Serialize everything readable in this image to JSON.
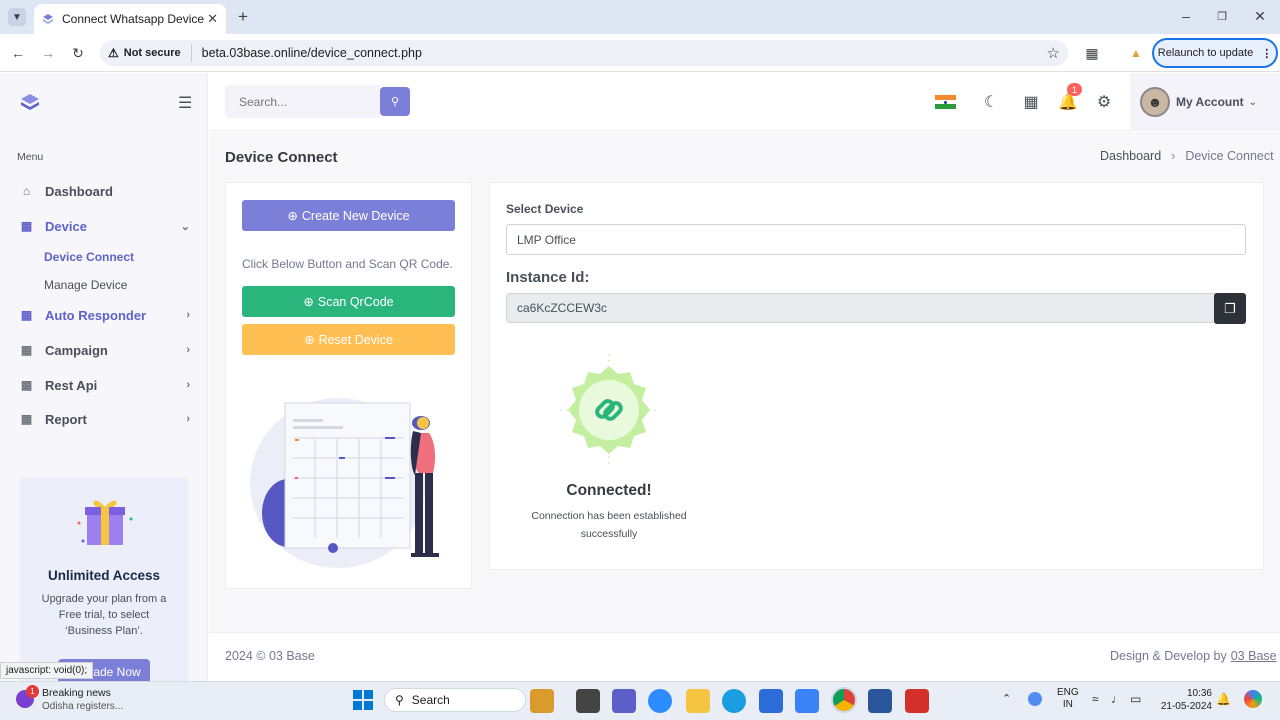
{
  "browser": {
    "tab_title": "Connect Whatsapp Device",
    "not_secure": "Not secure",
    "url": "beta.03base.online/device_connect.php",
    "relaunch": "Relaunch to update"
  },
  "sidebar": {
    "menu_heading": "Menu",
    "items": [
      {
        "label": "Dashboard",
        "icon": "home-icon"
      },
      {
        "label": "Device",
        "icon": "grid-icon"
      },
      {
        "label": "Auto Responder",
        "icon": "grid-icon"
      },
      {
        "label": "Campaign",
        "icon": "grid-icon"
      },
      {
        "label": "Rest Api",
        "icon": "grid-icon"
      },
      {
        "label": "Report",
        "icon": "grid-icon"
      }
    ],
    "subitems": [
      "Device Connect",
      "Manage Device"
    ],
    "promo": {
      "title": "Unlimited Access",
      "text": "Upgrade your plan from a Free trial, to select ‘Business Plan’.",
      "button": "Upgrade Now"
    }
  },
  "header": {
    "search_placeholder": "Search...",
    "notification_count": "1",
    "account_label": "My Account"
  },
  "page": {
    "title": "Device Connect",
    "breadcrumb": [
      "Dashboard",
      "Device Connect"
    ]
  },
  "left_card": {
    "create_button": "Create New Device",
    "instruction": "Click Below Button and Scan QR Code.",
    "scan_button": "Scan QrCode",
    "reset_button": "Reset Device"
  },
  "right_card": {
    "select_label": "Select Device",
    "select_value": "LMP Office",
    "instance_label": "Instance Id:",
    "instance_value": "ca6KcZCCEW3c",
    "status_title": "Connected!",
    "status_text": "Connection has been established successfully"
  },
  "footer": {
    "copyright": "2024 © 03 Base",
    "credit_prefix": "Design & Develop by",
    "credit_link": "03 Base"
  },
  "statusbar": {
    "text": "javascript: void(0);"
  },
  "taskbar": {
    "news_title": "Breaking news",
    "news_sub": "Odisha registers...",
    "news_badge": "1",
    "search": "Search",
    "lang1": "ENG",
    "lang2": "IN",
    "time": "10:36",
    "date": "21-05-2024"
  },
  "colors": {
    "primary": "#7b7fd8",
    "success": "#2ab57d",
    "warning": "#ffbf53",
    "badge": "#fd625e"
  }
}
